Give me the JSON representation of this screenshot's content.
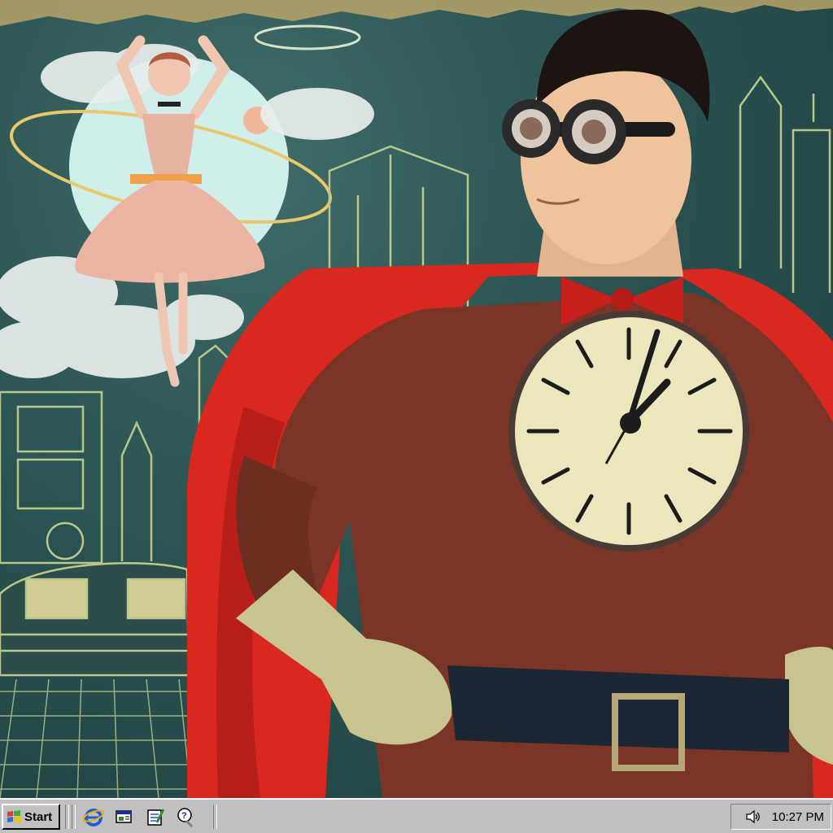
{
  "taskbar": {
    "start_label": "Start",
    "quick_launch": [
      {
        "icon": "internet-explorer-icon"
      },
      {
        "icon": "show-desktop-icon"
      },
      {
        "icon": "notepad-icon"
      },
      {
        "icon": "help-icon"
      }
    ],
    "tray": {
      "time": "10:27 PM",
      "volume_icon": "speaker-icon"
    }
  },
  "wallpaper": {
    "subject": "retro-collage-superhero-with-clock",
    "colors": {
      "cape": "#d8281f",
      "suit": "#7a3526",
      "clock_face": "#ece6bd",
      "sky": "#2c5553",
      "line_art": "#b9c78d"
    }
  }
}
